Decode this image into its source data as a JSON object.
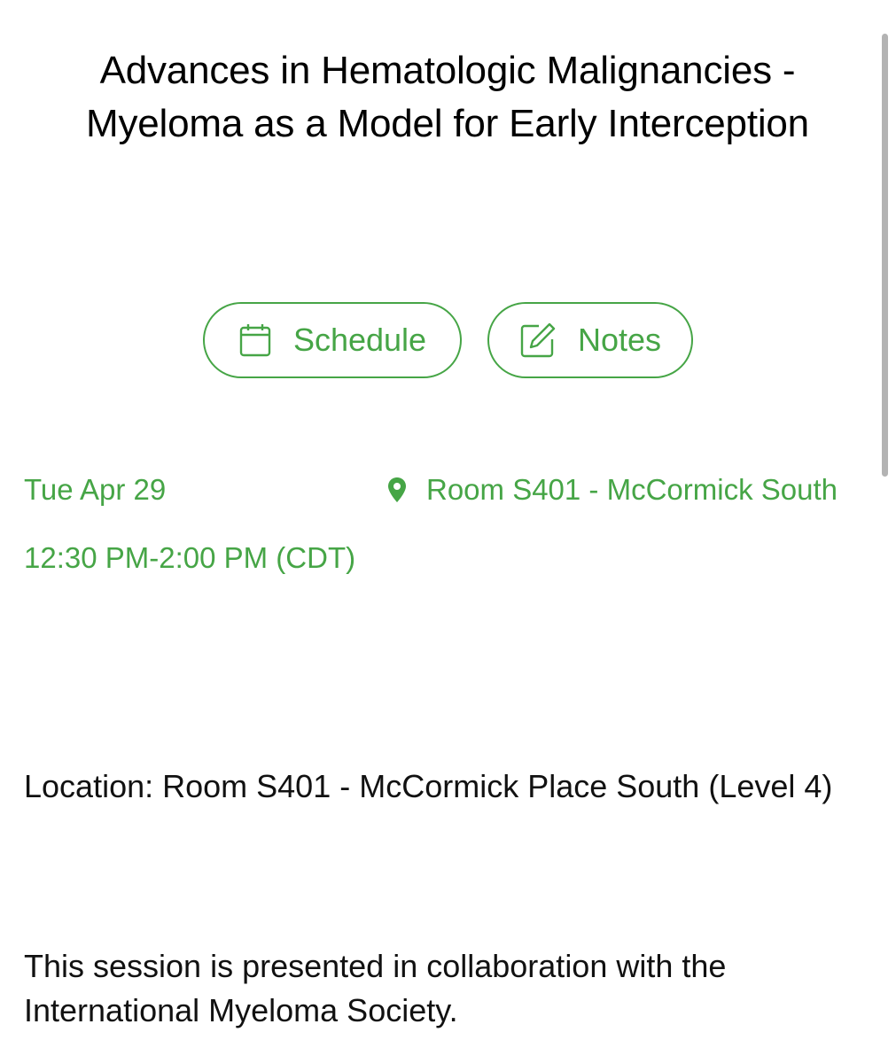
{
  "session": {
    "title": "Advances in Hematologic Malignancies - Myeloma as a Model for Early Interception",
    "date": "Tue Apr 29",
    "time": "12:30 PM-2:00 PM (CDT)",
    "room": "Room S401 - McCormick South",
    "location": "Location: Room S401 - McCormick Place South (Level 4)",
    "description": "This session is presented in collaboration with the International Myeloma Society."
  },
  "actions": {
    "schedule_label": "Schedule",
    "notes_label": "Notes"
  },
  "icons": {
    "schedule": "calendar-icon",
    "notes": "edit-note-icon",
    "room": "location-pin-icon"
  },
  "colors": {
    "accent": "#46a546",
    "text": "#111111",
    "scrollbar": "#b3b3b3"
  }
}
